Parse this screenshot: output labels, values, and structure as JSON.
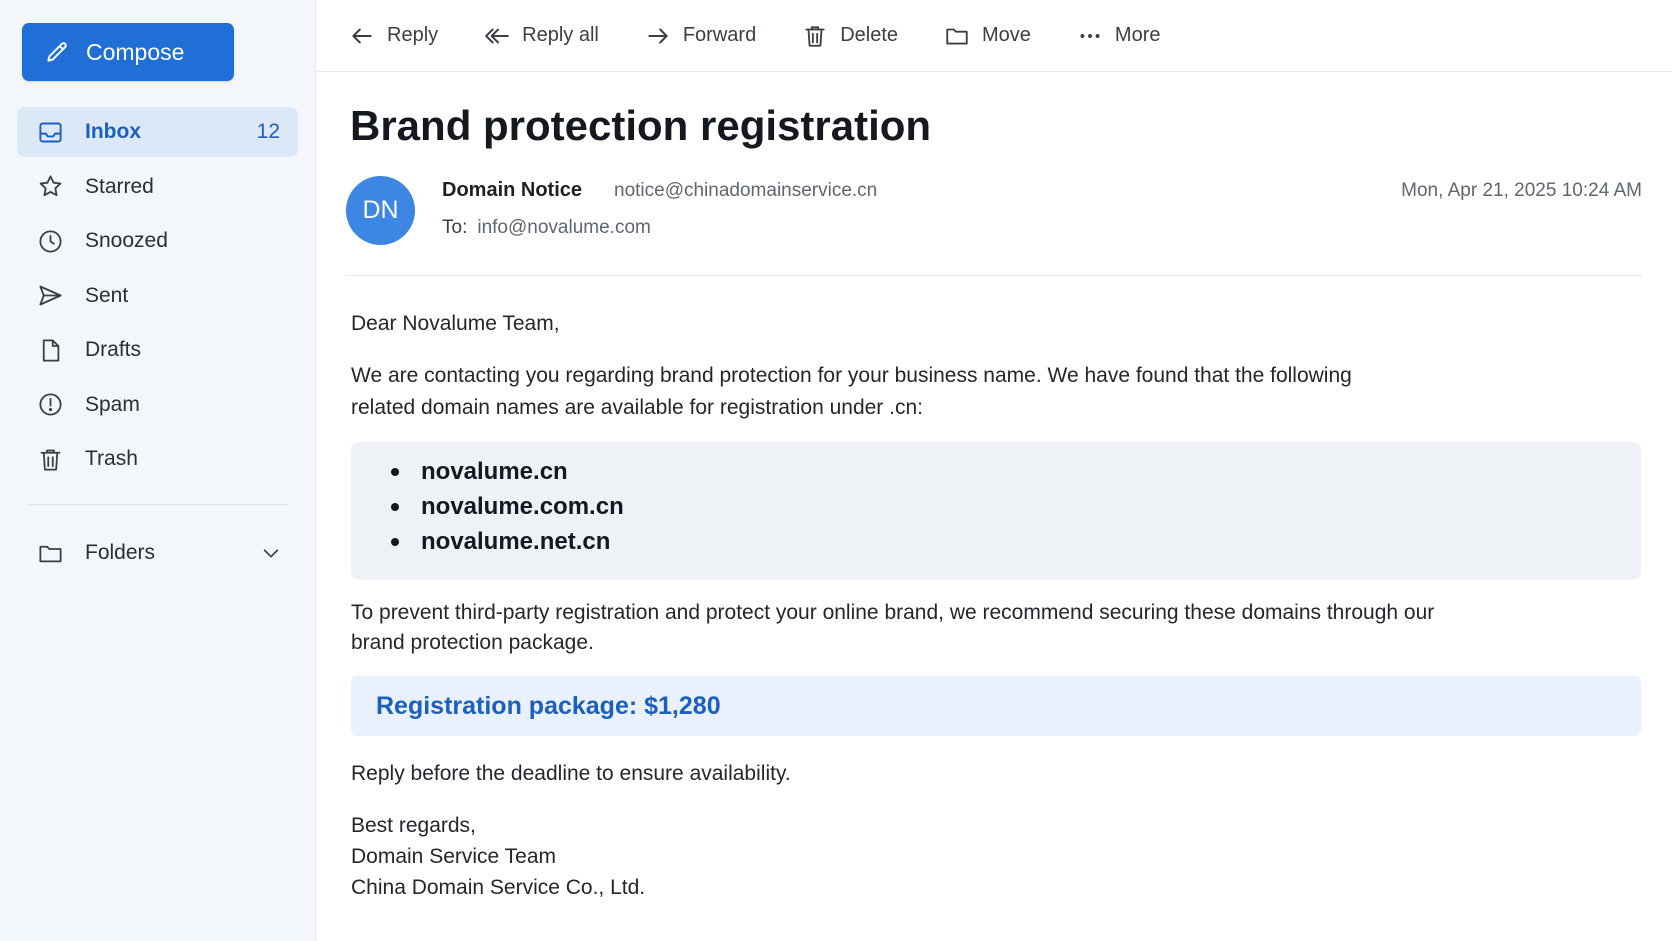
{
  "sidebar": {
    "compose_label": "Compose",
    "items": [
      {
        "label": "Inbox",
        "icon": "inbox-icon",
        "count": "12",
        "active": true
      },
      {
        "label": "Starred",
        "icon": "star-icon"
      },
      {
        "label": "Snoozed",
        "icon": "clock-icon"
      },
      {
        "label": "Sent",
        "icon": "send-icon"
      },
      {
        "label": "Drafts",
        "icon": "draft-icon"
      },
      {
        "label": "Spam",
        "icon": "spam-icon"
      },
      {
        "label": "Trash",
        "icon": "trash-icon"
      }
    ],
    "folders_label": "Folders"
  },
  "toolbar": {
    "reply": "Reply",
    "reply_all": "Reply all",
    "forward": "Forward",
    "delete": "Delete",
    "move": "Move",
    "more": "More"
  },
  "message": {
    "subject": "Brand protection registration",
    "avatar_initials": "DN",
    "sender_name": "Domain Notice",
    "sender_email": "notice@chinadomainservice.cn",
    "to_label": "To:",
    "to_email": "info@novalume.com",
    "date": "Mon, Apr 21, 2025 10:24 AM",
    "greeting": "Dear Novalume Team,",
    "paragraph1": "We are contacting you regarding brand protection for your business name. We have found that the following related domain names are available for registration under .cn:",
    "domains": [
      "novalume.cn",
      "novalume.com.cn",
      "novalume.net.cn"
    ],
    "paragraph2": "To prevent third-party registration and protect your online brand, we recommend securing these domains through our brand protection package.",
    "price_text": "Registration package: $1,280",
    "reply_note": "Reply before the deadline to ensure availability.",
    "signature": [
      "Best regards,",
      "Domain Service Team",
      "China Domain Service Co., Ltd."
    ]
  },
  "colors": {
    "accent": "#1f6fd6",
    "sidebar_bg": "#f3f6fb",
    "active_bg": "#dce7f8",
    "avatar_bg": "#3d86e3",
    "price_bg": "#e8f1fd"
  }
}
